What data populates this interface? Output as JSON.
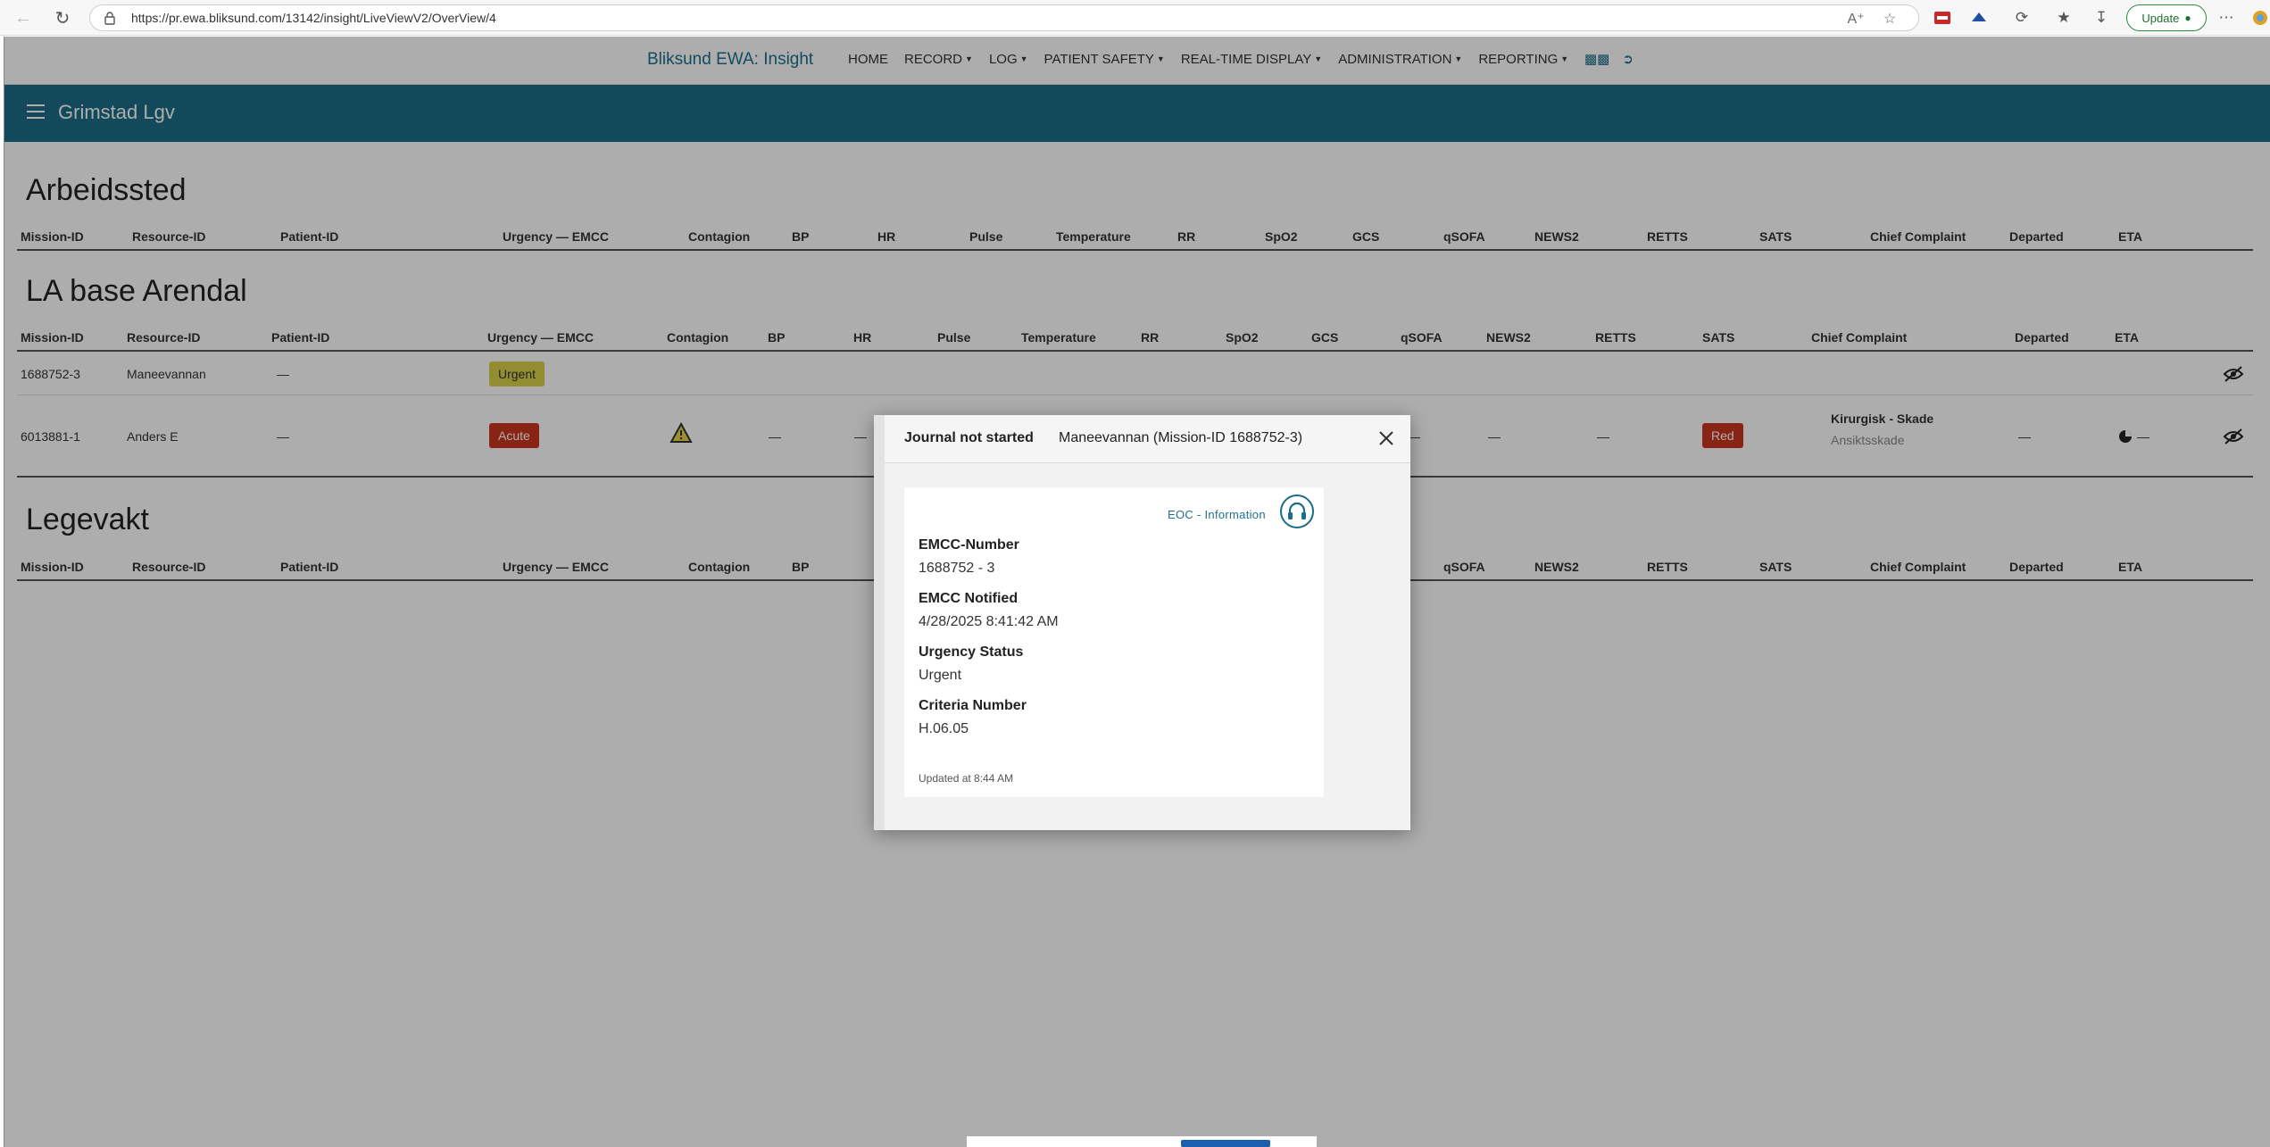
{
  "browser": {
    "url": "https://pr.ewa.bliksund.com/13142/insight/LiveViewV2/OverView/4",
    "update_label": "Update"
  },
  "app": {
    "brand": "Bliksund EWA: Insight",
    "nav": [
      "HOME",
      "RECORD",
      "LOG",
      "PATIENT SAFETY",
      "REAL-TIME DISPLAY",
      "ADMINISTRATION",
      "REPORTING"
    ],
    "title": "Grimstad Lgv"
  },
  "sections": [
    {
      "title": "Arbeidssted",
      "columns": [
        "Mission-ID",
        "Resource-ID",
        "Patient-ID",
        "Urgency — EMCC",
        "Contagion",
        "BP",
        "HR",
        "Pulse",
        "Temperature",
        "RR",
        "SpO2",
        "GCS",
        "qSOFA",
        "NEWS2",
        "RETTS",
        "SATS",
        "Chief Complaint",
        "Departed",
        "ETA"
      ]
    },
    {
      "title": "LA base Arendal",
      "columns": [
        "Mission-ID",
        "Resource-ID",
        "Patient-ID",
        "Urgency — EMCC",
        "Contagion",
        "BP",
        "HR",
        "Pulse",
        "Temperature",
        "RR",
        "SpO2",
        "GCS",
        "qSOFA",
        "NEWS2",
        "RETTS",
        "SATS",
        "Chief Complaint",
        "Departed",
        "ETA"
      ],
      "rows": [
        {
          "mission": "1688752-3",
          "resource": "Maneevannan",
          "patient": "—",
          "urgency": "Urgent"
        },
        {
          "mission": "6013881-1",
          "resource": "Anders E",
          "patient": "—",
          "urgency": "Acute",
          "bp": "—",
          "hr": "—",
          "gcs": "—",
          "news2": "—",
          "retts": "—",
          "sats": "Red",
          "complaint_main": "Kirurgisk - Skade",
          "complaint_sub": "Ansiktsskade",
          "departed": "—",
          "eta": "—"
        }
      ]
    },
    {
      "title": "Legevakt",
      "columns": [
        "Mission-ID",
        "Resource-ID",
        "Patient-ID",
        "Urgency — EMCC",
        "Contagion",
        "BP",
        "qSOFA",
        "NEWS2",
        "RETTS",
        "SATS",
        "Chief Complaint",
        "Departed",
        "ETA"
      ]
    }
  ],
  "modal": {
    "status": "Journal not started",
    "name": "Maneevannan (Mission-ID 1688752-3)",
    "eoc_label": "EOC - Information",
    "fields": [
      {
        "label": "EMCC-Number",
        "value": "1688752 - 3"
      },
      {
        "label": "EMCC Notified",
        "value": "4/28/2025 8:41:42 AM"
      },
      {
        "label": "Urgency Status",
        "value": "Urgent"
      },
      {
        "label": "Criteria Number",
        "value": "H.06.05"
      }
    ],
    "updated": "Updated at 8:44 AM"
  },
  "colors": {
    "brand_teal": "#1b6c86",
    "urgent_yellow": "#d9d04a",
    "acute_red": "#c9341f"
  }
}
